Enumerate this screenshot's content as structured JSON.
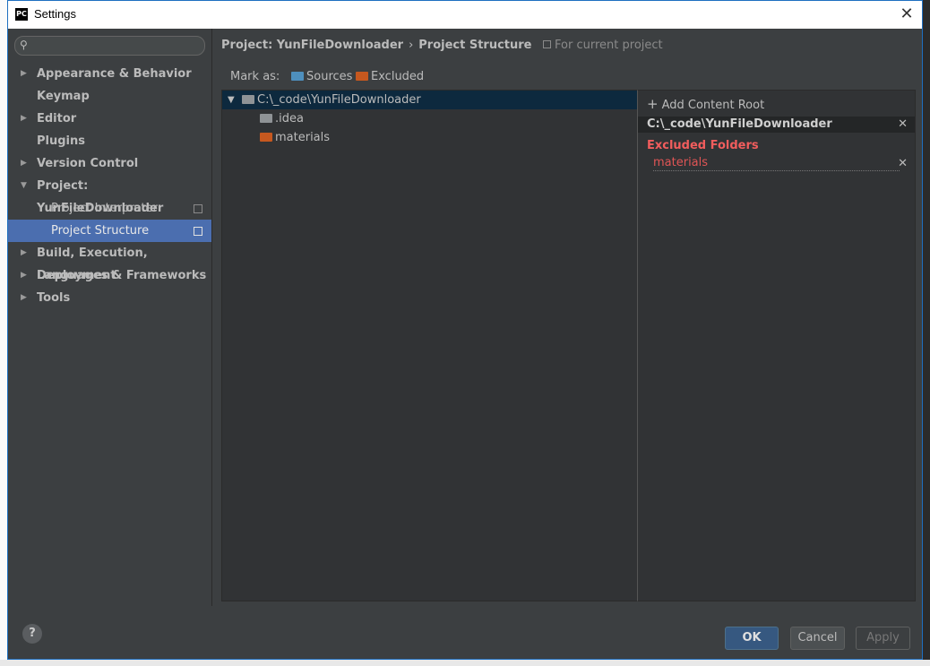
{
  "window": {
    "title": "Settings"
  },
  "sidebar": {
    "search_placeholder": "",
    "items": [
      {
        "label": "Appearance & Behavior",
        "expandable": true
      },
      {
        "label": "Keymap"
      },
      {
        "label": "Editor",
        "expandable": true
      },
      {
        "label": "Plugins"
      },
      {
        "label": "Version Control",
        "expandable": true
      },
      {
        "label": "Project: YunFileDownloader",
        "expanded": true
      },
      {
        "label": "Project Interpreter",
        "child": true
      },
      {
        "label": "Project Structure",
        "child": true,
        "selected": true
      },
      {
        "label": "Build, Execution, Deployment",
        "expandable": true
      },
      {
        "label": "Languages & Frameworks",
        "expandable": true
      },
      {
        "label": "Tools",
        "expandable": true
      }
    ]
  },
  "breadcrumb": {
    "parent": "Project: YunFileDownloader",
    "separator": "›",
    "current": "Project Structure",
    "hint": "For current project"
  },
  "mark_as": {
    "label": "Mark as:",
    "sources": "Sources",
    "excluded": "Excluded"
  },
  "file_tree": {
    "root": "C:\\_code\\YunFileDownloader",
    "children": [
      ".idea",
      "materials"
    ]
  },
  "content_root": {
    "add_label": "Add Content Root",
    "path": "C:\\_code\\YunFileDownloader",
    "excluded_title": "Excluded Folders",
    "excluded_items": [
      "materials"
    ]
  },
  "footer": {
    "help": "?",
    "ok": "OK",
    "cancel": "Cancel",
    "apply": "Apply"
  },
  "colors": {
    "selection": "#4b6eaf",
    "excluded": "#c6581f",
    "sources": "#4e8fbd",
    "excluded_text": "#f25d5d"
  }
}
